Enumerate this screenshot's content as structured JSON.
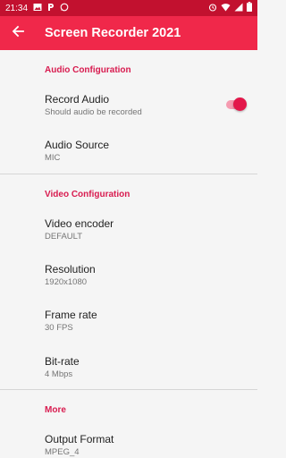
{
  "status_bar": {
    "time": "21:34"
  },
  "app_bar": {
    "title": "Screen Recorder 2021"
  },
  "sections": {
    "audio": {
      "header": "Audio Configuration",
      "record_audio": {
        "title": "Record Audio",
        "summary": "Should audio be recorded",
        "enabled": true
      },
      "audio_source": {
        "title": "Audio Source",
        "value": "MIC"
      }
    },
    "video": {
      "header": "Video Configuration",
      "encoder": {
        "title": "Video encoder",
        "value": "DEFAULT"
      },
      "resolution": {
        "title": "Resolution",
        "value": "1920x1080"
      },
      "frame_rate": {
        "title": "Frame rate",
        "value": "30 FPS"
      },
      "bit_rate": {
        "title": "Bit-rate",
        "value": "4 Mbps"
      }
    },
    "more": {
      "header": "More",
      "output_format": {
        "title": "Output Format",
        "value": "MPEG_4"
      }
    }
  },
  "colors": {
    "status_bar": "#c2112f",
    "app_bar": "#f0284a",
    "accent": "#d81b4f",
    "switch_thumb": "#e3174a",
    "switch_track": "#f59bb0"
  },
  "icons": [
    "gallery-icon",
    "p-icon",
    "whatsapp-icon",
    "alarm-icon",
    "wifi-icon",
    "signal-icon",
    "battery-icon",
    "back-arrow-icon"
  ]
}
